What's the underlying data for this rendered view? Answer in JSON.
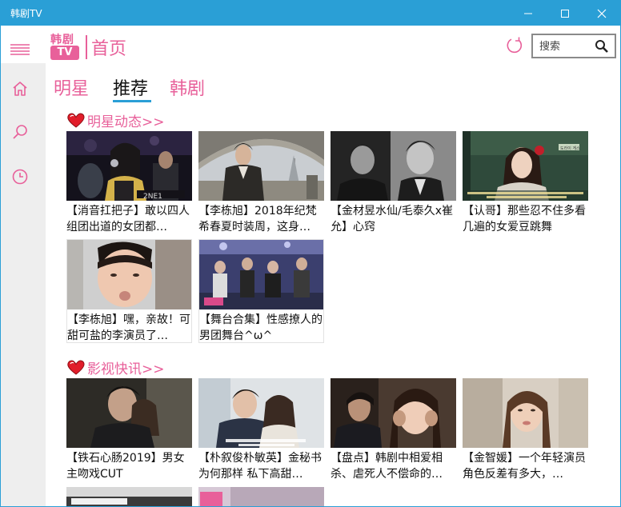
{
  "window": {
    "title": "韩剧TV"
  },
  "brand": {
    "line1": "韩剧",
    "line2": "TV"
  },
  "header": {
    "page_title": "首页"
  },
  "search": {
    "placeholder": "搜索"
  },
  "tabs": [
    {
      "label": "明星"
    },
    {
      "label": "推荐"
    },
    {
      "label": "韩剧"
    }
  ],
  "sections": [
    {
      "title": "明星动态>>",
      "items": [
        {
          "caption": "【消音扛把子】敢以四人组团出道的女团都…"
        },
        {
          "caption": "【李栋旭】2018年纪梵希春夏时装周，这身…"
        },
        {
          "caption": "【金材昱水仙/毛泰久x崔允】心窍"
        },
        {
          "caption": "【认哥】那些忍不住多看几遍的女爱豆跳舞"
        },
        {
          "caption": "【李栋旭】嘿，亲故！可甜可盐的李演员了…"
        },
        {
          "caption": "【舞台合集】性感撩人的男团舞台^ω^"
        }
      ]
    },
    {
      "title": "影视快讯>>",
      "items": [
        {
          "caption": "【铁石心肠2019】男女主吻戏CUT"
        },
        {
          "caption": "【朴叙俊朴敏英】金秘书为何那样 私下高甜…"
        },
        {
          "caption": "【盘点】韩剧中相爱相杀、虐死人不偿命的…"
        },
        {
          "caption": "【金智媛】一个年轻演员角色反差有多大，…"
        }
      ]
    }
  ],
  "thumbnail_text": {
    "s0_0": "2NE1",
    "s0_3": "도라이 게스"
  },
  "colors": {
    "titlebar": "#2a9fd6",
    "accent": "#e8609a",
    "tab_underline": "#2a9fd6",
    "nav_rail": "#eeeeee"
  },
  "icons": {
    "menu": "hamburger-icon",
    "nav": [
      "home-icon",
      "search-icon",
      "history-clock-icon"
    ],
    "refresh": "refresh-icon",
    "search": "magnifier-icon",
    "section": "heart-icon"
  }
}
